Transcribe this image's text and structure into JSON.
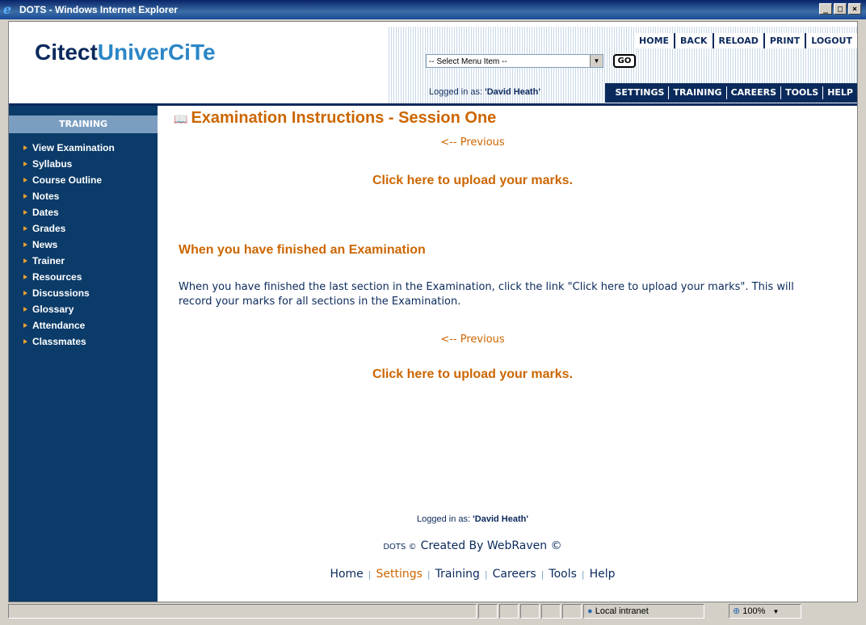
{
  "window": {
    "title": "DOTS - Windows Internet Explorer"
  },
  "logo": {
    "part1": "Citect",
    "part2": "UniverCiTe"
  },
  "top_nav": [
    "HOME",
    "BACK",
    "RELOAD",
    "PRINT",
    "LOGOUT"
  ],
  "menu_select": {
    "value": "-- Select Menu Item --"
  },
  "go_button": "GO",
  "logged_in": {
    "prefix": "Logged in as:",
    "user": "'David Heath'"
  },
  "main_nav": [
    "SETTINGS",
    "TRAINING",
    "CAREERS",
    "TOOLS",
    "HELP"
  ],
  "sidebar": {
    "heading": "TRAINING",
    "items": [
      "View Examination",
      "Syllabus",
      "Course Outline",
      "Notes",
      "Dates",
      "Grades",
      "News",
      "Trainer",
      "Resources",
      "Discussions",
      "Glossary",
      "Attendance",
      "Classmates"
    ]
  },
  "content": {
    "title": "Examination Instructions - Session One",
    "previous": "<-- Previous",
    "upload": "Click here to upload your marks.",
    "section_heading": "When you have finished an Examination",
    "paragraph": "When you have finished the last section in the Examination, click the link \"Click here to upload your marks\". This will record your marks for all sections in the Examination."
  },
  "footer": {
    "dots": "DOTS ©",
    "created": "Created By WebRaven ©",
    "nav": [
      "Home",
      "Settings",
      "Training",
      "Careers",
      "Tools",
      "Help"
    ]
  },
  "status_bar": {
    "zone": "Local intranet",
    "zoom": "100%"
  }
}
